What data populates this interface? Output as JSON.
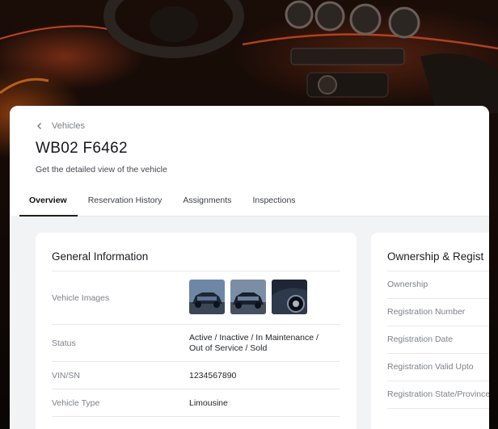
{
  "breadcrumb": {
    "parent": "Vehicles"
  },
  "header": {
    "title": "WB02 F6462",
    "subtitle": "Get the detailed view of the vehicle"
  },
  "tabs": [
    {
      "label": "Overview",
      "active": true
    },
    {
      "label": "Reservation History",
      "active": false
    },
    {
      "label": "Assignments",
      "active": false
    },
    {
      "label": "Inspections",
      "active": false
    }
  ],
  "general": {
    "title": "General Information",
    "rows": {
      "images_label": "Vehicle Images",
      "status_label": "Status",
      "status_line1": "Active / Inactive / In Maintenance /",
      "status_line2": "Out of Service / Sold",
      "vin_label": "VIN/SN",
      "vin_value": "1234567890",
      "type_label": "Vehicle Type",
      "type_value": "Limousine"
    }
  },
  "ownership": {
    "title": "Ownership & Regist",
    "labels": [
      "Ownership",
      "Registration Number",
      "Registration Date",
      "Registration Valid Upto",
      "Registration State/Province"
    ]
  },
  "colors": {
    "accent_tab_underline": "#1d1f23",
    "page_bg": "#f2f3f5",
    "ambient_light": "#c2461e"
  }
}
